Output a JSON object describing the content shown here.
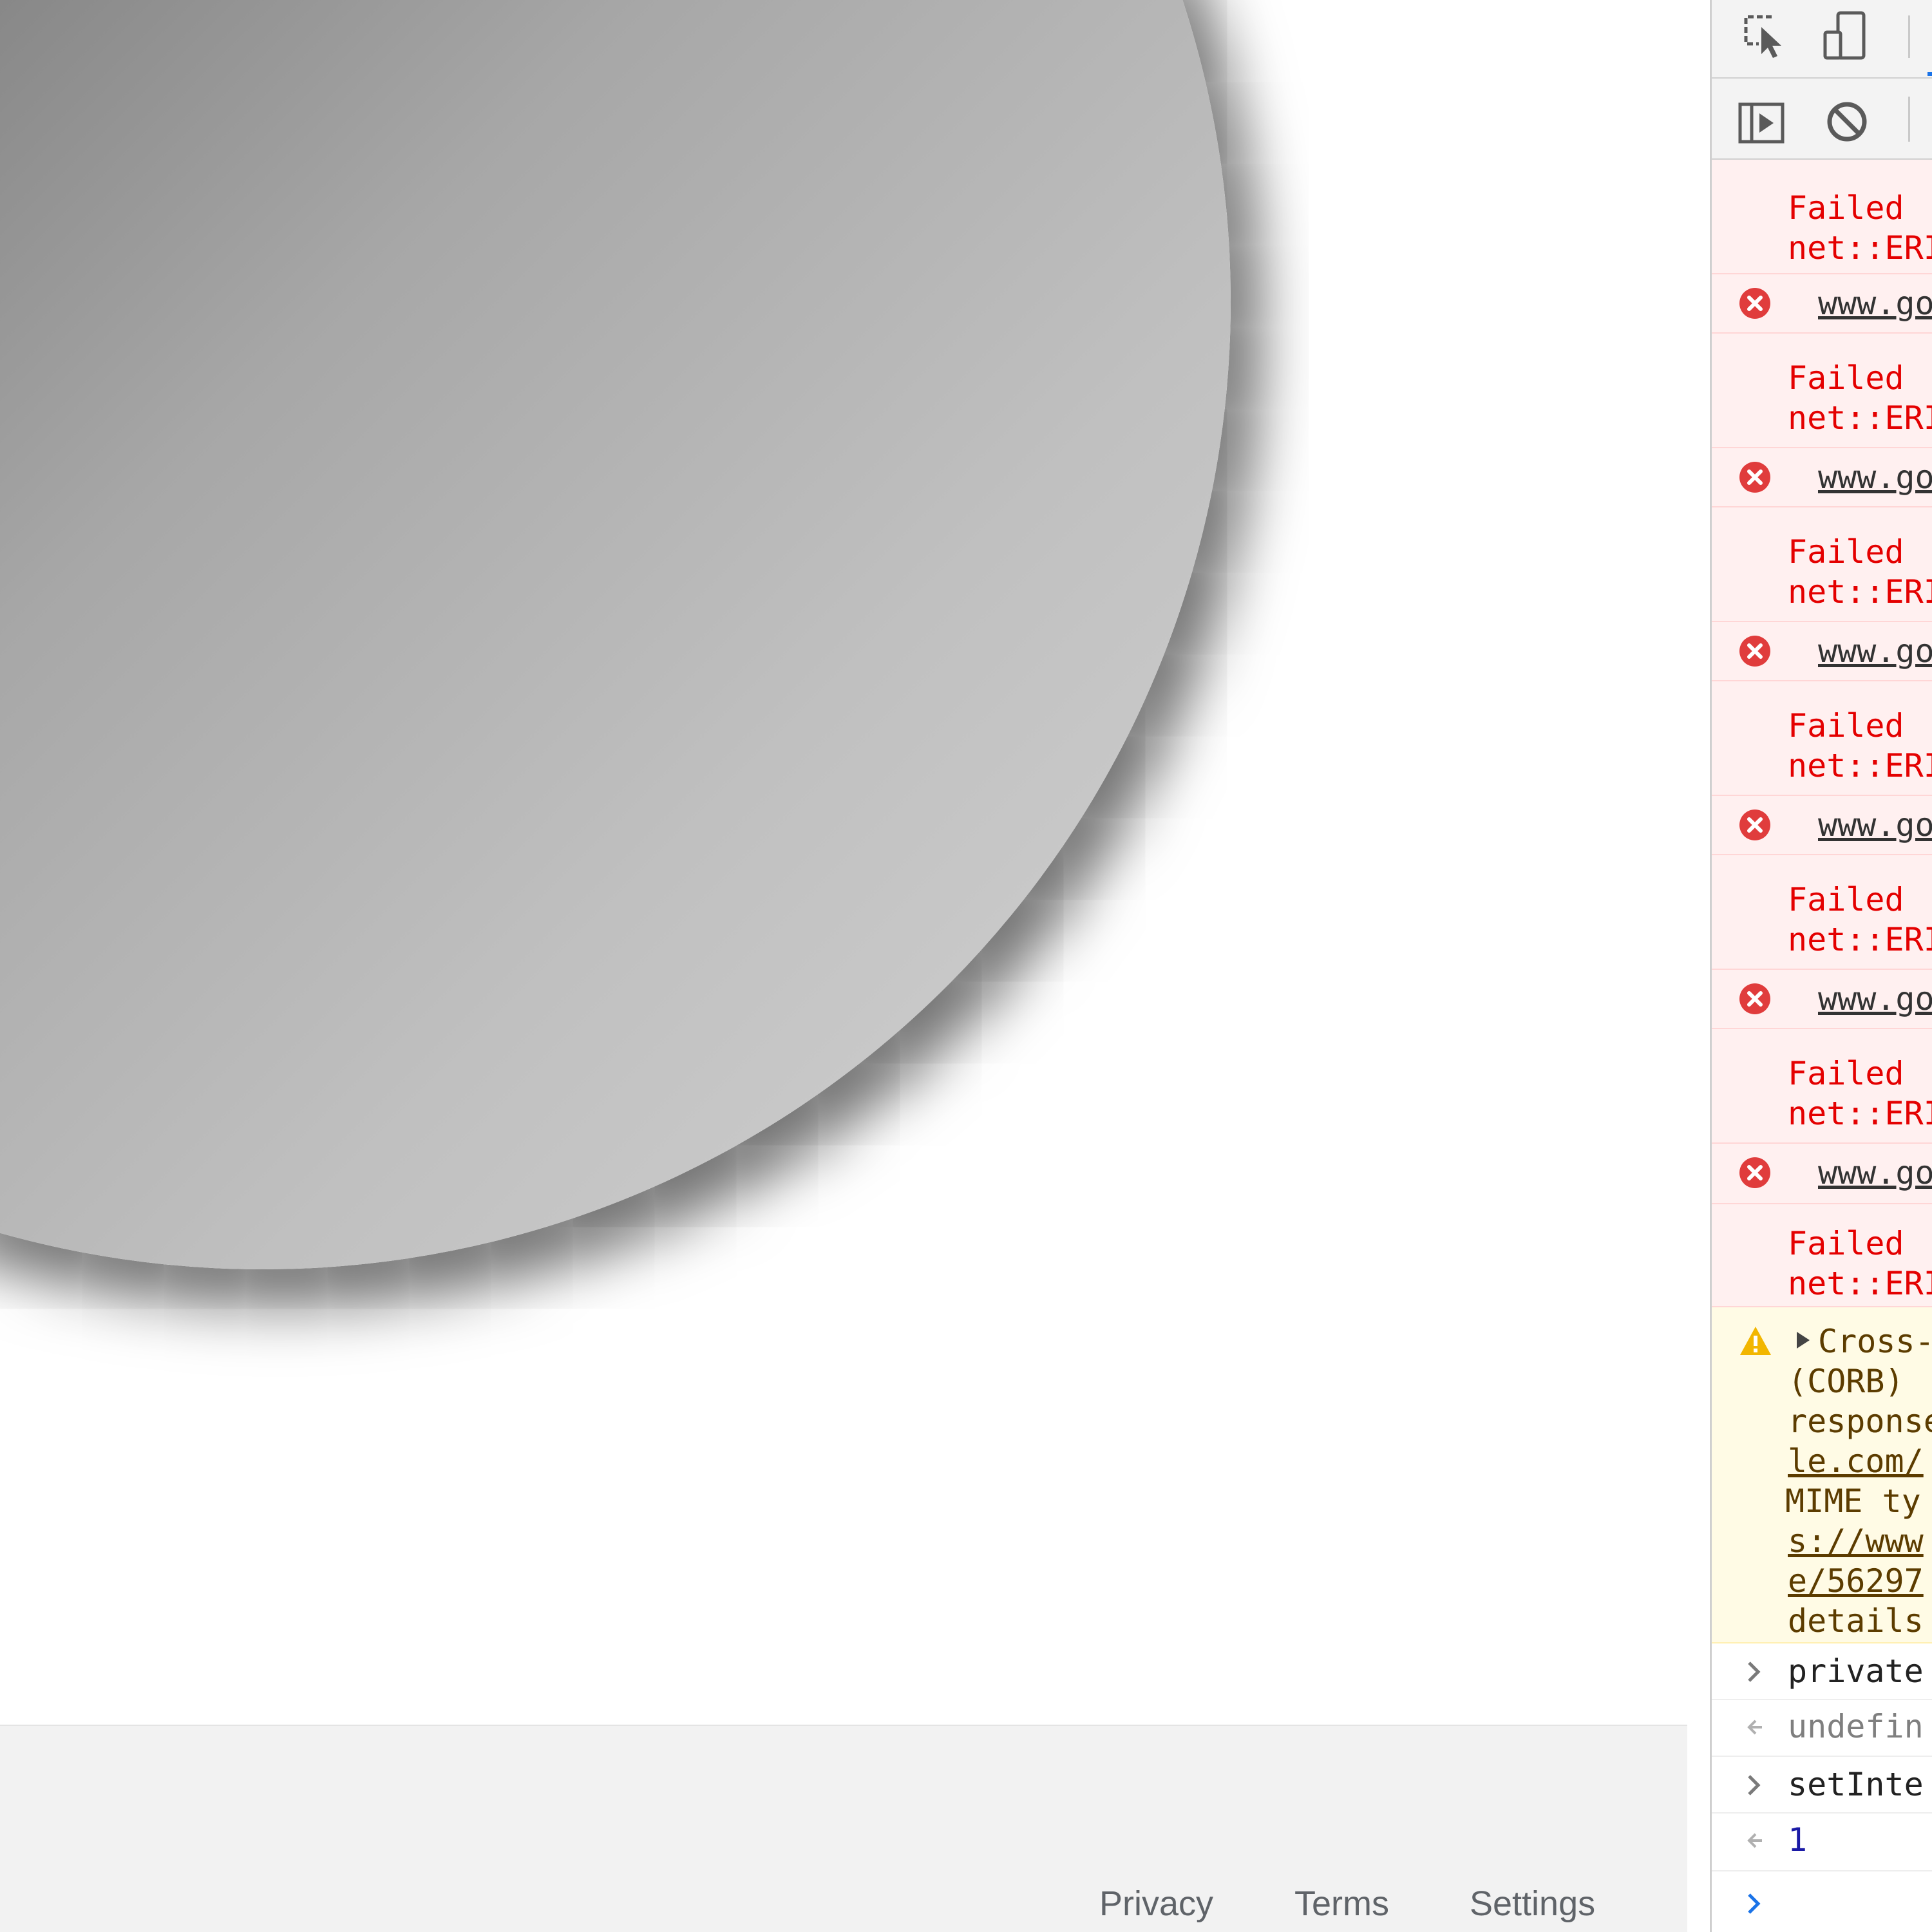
{
  "page": {
    "footer": {
      "privacy": "Privacy",
      "terms": "Terms",
      "settings": "Settings"
    }
  },
  "devtools": {
    "toolbar_icons": [
      "inspect-element-icon",
      "device-toolbar-icon",
      "show-sidebar-icon",
      "clear-console-icon"
    ],
    "console": {
      "errors": [
        {
          "message": [
            "Failed ",
            "net::ERI"
          ],
          "source": "www.go"
        },
        {
          "message": [
            "Failed ",
            "net::ERI"
          ],
          "source": "www.go"
        },
        {
          "message": [
            "Failed ",
            "net::ERI"
          ],
          "source": "www.go"
        },
        {
          "message": [
            "Failed ",
            "net::ERI"
          ],
          "source": "www.go"
        },
        {
          "message": [
            "Failed ",
            "net::ERI"
          ],
          "source": "www.go"
        },
        {
          "message": [
            "Failed ",
            "net::ERI"
          ],
          "source": "www.go"
        },
        {
          "message": [
            "Failed ",
            "net::ERI"
          ]
        }
      ],
      "warning": {
        "lines": [
          "Cross-",
          "(CORB) ",
          "response",
          "le.com/",
          "MIME ty",
          "s://www",
          "e/56297",
          "details"
        ]
      },
      "history": [
        {
          "kind": "input",
          "text": "private"
        },
        {
          "kind": "result",
          "text": "undefin"
        },
        {
          "kind": "input",
          "text": "setInte"
        },
        {
          "kind": "result",
          "text": "1"
        }
      ]
    }
  },
  "colors": {
    "error_text": "#e40000",
    "error_bg": "#fff0f0",
    "warning_bg": "#fffbe5",
    "warning_text": "#5c3c00",
    "result_number": "#1a1aa6",
    "prompt_blue": "#1a73e8",
    "footer_text": "#5f6368"
  }
}
